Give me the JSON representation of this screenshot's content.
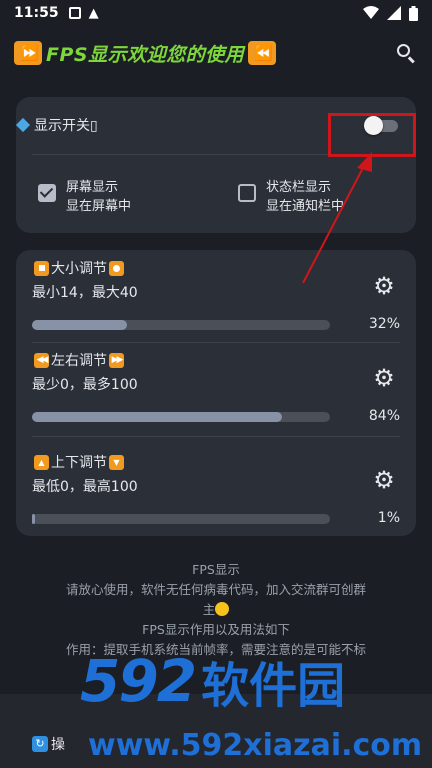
{
  "status_bar": {
    "time": "11:55",
    "warning_glyph": "▲",
    "icons": [
      "gallery-icon",
      "warning-icon",
      "wifi-icon",
      "cell-signal-icon",
      "battery-icon"
    ]
  },
  "app_bar": {
    "title": "FPS显示欢迎您的使用",
    "left_icon_glyph": "⏩",
    "right_icon_glyph": "⏪"
  },
  "display_switch": {
    "label": "显示开关▯",
    "enabled": false
  },
  "options": {
    "screen": {
      "title": "屏幕显示",
      "subtitle": "显在屏幕中",
      "checked": true
    },
    "statusbar": {
      "title": "状态栏显示",
      "subtitle": "显在通知栏中",
      "checked": false
    }
  },
  "sliders": [
    {
      "prefix_icon": "stop-button-icon",
      "title": "大小调节",
      "suffix_icon": "record-button-icon",
      "range": "最小14，最大40",
      "percent_label": "32%",
      "value": 0.32
    },
    {
      "prefix_icon": "rewind-icon",
      "title": "左右调节",
      "suffix_icon": "fast-forward-icon",
      "range": "最少0，最多100",
      "percent_label": "84%",
      "value": 0.84
    },
    {
      "prefix_icon": "fast-up-icon",
      "title": "上下调节",
      "suffix_icon": "fast-down-icon",
      "range": "最低0，最高100",
      "percent_label": "1%",
      "value": 0.01
    }
  ],
  "info": {
    "line1": "FPS显示",
    "line2": "请放心使用，软件无任何病毒代码，加入交流群可创群",
    "line3": "主",
    "line4": "FPS显示作用以及用法如下",
    "line5": "作用：提取手机系统当前帧率，需要注意的是可能不标"
  },
  "bottom": {
    "item_label": "操"
  },
  "watermark": {
    "number": "592",
    "text": "软件园",
    "url": "www.592xiazai.com"
  },
  "colors": {
    "background": "#1b1e24",
    "card": "#2b2f37",
    "title_green": "#7dd63a",
    "annotation_red": "#d0161b",
    "watermark_blue": "#1e6fd6",
    "slider_fill": "#8892a6"
  }
}
